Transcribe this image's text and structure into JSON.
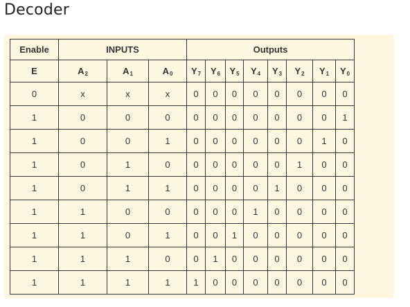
{
  "title": "Decoder",
  "table": {
    "group_headers": {
      "enable": "Enable",
      "inputs": "INPUTS",
      "outputs": "Outputs"
    },
    "columns": [
      {
        "base": "E",
        "sub": ""
      },
      {
        "base": "A",
        "sub": "2"
      },
      {
        "base": "A",
        "sub": "1"
      },
      {
        "base": "A",
        "sub": "0"
      },
      {
        "base": "Y",
        "sub": "7"
      },
      {
        "base": "Y",
        "sub": "6"
      },
      {
        "base": "Y",
        "sub": "5"
      },
      {
        "base": "Y",
        "sub": "4"
      },
      {
        "base": "Y",
        "sub": "3"
      },
      {
        "base": "Y",
        "sub": "2"
      },
      {
        "base": "Y",
        "sub": "1"
      },
      {
        "base": "Y",
        "sub": "0"
      }
    ],
    "rows": [
      [
        "0",
        "x",
        "x",
        "x",
        "0",
        "0",
        "0",
        "0",
        "0",
        "0",
        "0",
        "0"
      ],
      [
        "1",
        "0",
        "0",
        "0",
        "0",
        "0",
        "0",
        "0",
        "0",
        "0",
        "0",
        "1"
      ],
      [
        "1",
        "0",
        "0",
        "1",
        "0",
        "0",
        "0",
        "0",
        "0",
        "0",
        "1",
        "0"
      ],
      [
        "1",
        "0",
        "1",
        "0",
        "0",
        "0",
        "0",
        "0",
        "0",
        "1",
        "0",
        "0"
      ],
      [
        "1",
        "0",
        "1",
        "1",
        "0",
        "0",
        "0",
        "0",
        "1",
        "0",
        "0",
        "0"
      ],
      [
        "1",
        "1",
        "0",
        "0",
        "0",
        "0",
        "0",
        "1",
        "0",
        "0",
        "0",
        "0"
      ],
      [
        "1",
        "1",
        "0",
        "1",
        "0",
        "0",
        "1",
        "0",
        "0",
        "0",
        "0",
        "0"
      ],
      [
        "1",
        "1",
        "1",
        "0",
        "0",
        "1",
        "0",
        "0",
        "0",
        "0",
        "0",
        "0"
      ],
      [
        "1",
        "1",
        "1",
        "1",
        "1",
        "0",
        "0",
        "0",
        "0",
        "0",
        "0",
        "0"
      ]
    ]
  }
}
